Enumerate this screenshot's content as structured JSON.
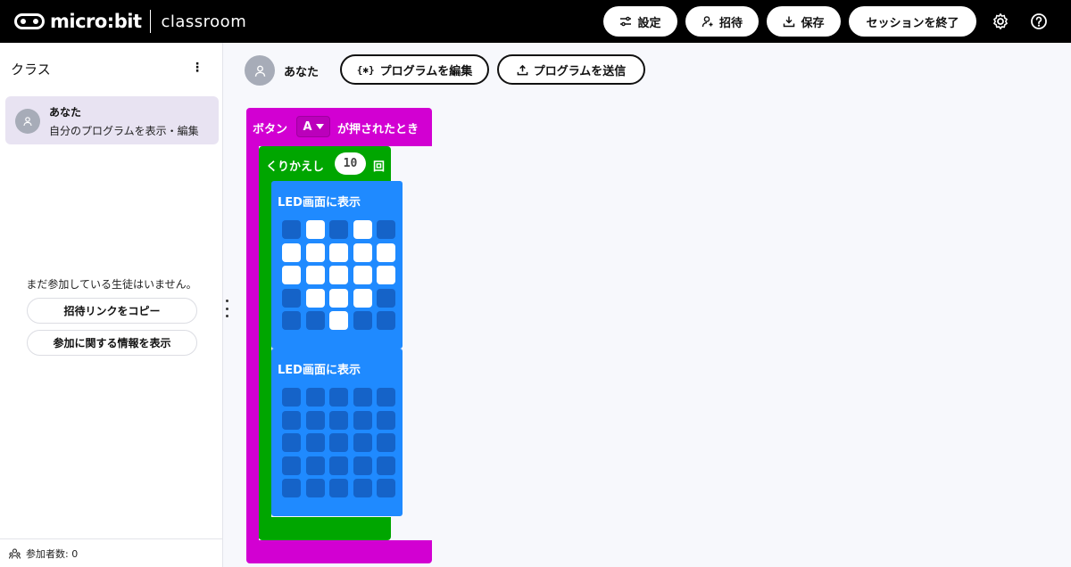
{
  "header": {
    "logo_text": "micro:bit",
    "subtitle": "classroom",
    "buttons": {
      "settings": "設定",
      "invite": "招待",
      "save": "保存",
      "end_session": "セッションを終了"
    }
  },
  "sidebar": {
    "title": "クラス",
    "student": {
      "name": "あなた",
      "description": "自分のプログラムを表示・編集"
    },
    "empty_message": "まだ参加している生徒はいません。",
    "copy_invite_link": "招待リンクをコピー",
    "show_join_info": "参加に関する情報を表示",
    "participant_count": "参加者数: 0"
  },
  "workspace": {
    "user_name": "あなた",
    "edit_program": "プログラムを編集",
    "send_program": "プログラムを送信"
  },
  "blocks": {
    "event": {
      "prefix": "ボタン",
      "button": "A",
      "suffix": "が押されたとき"
    },
    "loop": {
      "prefix": "くりかえし",
      "count": "10",
      "suffix": "回"
    },
    "show_leds_1": {
      "label": "LED画面に表示",
      "grid": [
        [
          0,
          1,
          0,
          1,
          0
        ],
        [
          1,
          1,
          1,
          1,
          1
        ],
        [
          1,
          1,
          1,
          1,
          1
        ],
        [
          0,
          1,
          1,
          1,
          0
        ],
        [
          0,
          0,
          1,
          0,
          0
        ]
      ]
    },
    "show_leds_2": {
      "label": "LED画面に表示",
      "grid": [
        [
          0,
          0,
          0,
          0,
          0
        ],
        [
          0,
          0,
          0,
          0,
          0
        ],
        [
          0,
          0,
          0,
          0,
          0
        ],
        [
          0,
          0,
          0,
          0,
          0
        ],
        [
          0,
          0,
          0,
          0,
          0
        ]
      ]
    }
  },
  "colors": {
    "event_block": "#d200d2",
    "loop_block": "#00a600",
    "led_block": "#1f8aff",
    "led_on": "#ffffff",
    "led_off": "#1563c8"
  }
}
